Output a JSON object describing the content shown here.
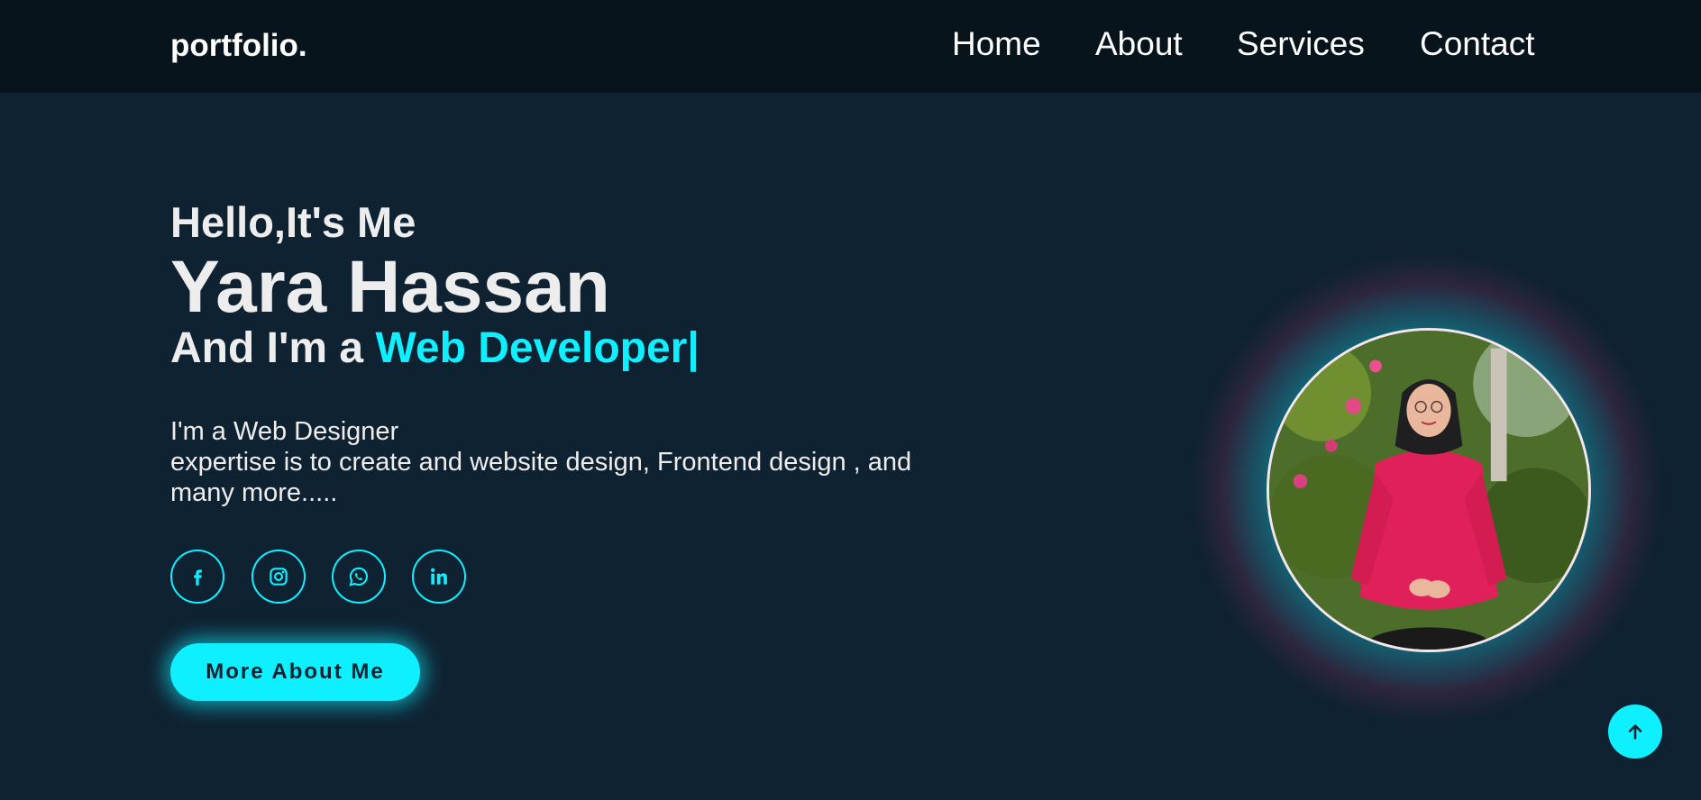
{
  "nav": {
    "logo": "portfolio.",
    "links": [
      "Home",
      "About",
      "Services",
      "Contact"
    ]
  },
  "hero": {
    "greeting": "Hello,It's Me",
    "name": "Yara Hassan",
    "role_prefix": "And I'm a ",
    "role": "Web Developer|",
    "description_line1": "I'm a Web Designer",
    "description_line2": "expertise is to create and website design, Frontend design , and many more.....",
    "cta_label": "More About Me"
  },
  "socials": [
    {
      "name": "facebook-icon"
    },
    {
      "name": "instagram-icon"
    },
    {
      "name": "whatsapp-icon"
    },
    {
      "name": "linkedin-icon"
    }
  ],
  "icons": {
    "scroll_top": "arrow-up-icon",
    "profile": "profile-photo"
  },
  "colors": {
    "background": "#0f2232",
    "navbar": "#08141c",
    "accent": "#0ef0ff",
    "text": "#ededed"
  }
}
